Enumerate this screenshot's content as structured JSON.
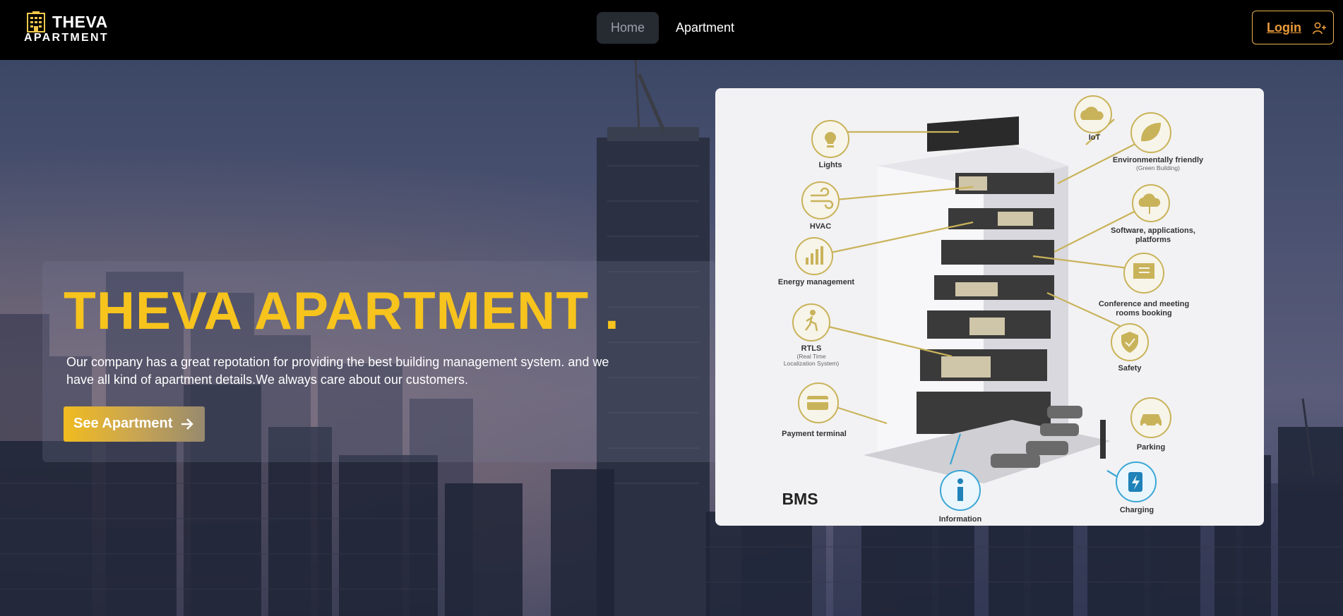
{
  "nav": {
    "logo_line1": "THEVA",
    "logo_line2": "APARTMENT",
    "links": [
      {
        "label": "Home",
        "active": true
      },
      {
        "label": "Apartment",
        "active": false
      }
    ],
    "login_label": "Login",
    "login_icon": "user-plus-icon"
  },
  "hero": {
    "title": "THEVA APARTMENT .",
    "description": "Our company has a great repotation for providing the best building management system. and we have all kind of apartment details.We always care about our customers.",
    "cta_label": "See Apartment",
    "cta_icon": "arrow-right-icon",
    "accent_color": "#f7c31d"
  },
  "bms": {
    "title": "BMS",
    "features": [
      {
        "label": "Lights",
        "icon": "lightbulb-icon"
      },
      {
        "label": "HVAC",
        "icon": "wind-icon"
      },
      {
        "label": "Energy management",
        "icon": "bar-chart-icon"
      },
      {
        "label": "RTLS",
        "sub": "(Real Time Localization System)",
        "icon": "walking-person-icon"
      },
      {
        "label": "Payment terminal",
        "icon": "credit-card-icon"
      },
      {
        "label": "Information",
        "icon": "info-icon"
      },
      {
        "label": "IoT",
        "icon": "cloud-wifi-icon"
      },
      {
        "label": "Environmentally friendly",
        "sub": "(Green Building)",
        "icon": "leaf-icon"
      },
      {
        "label": "Software, applications, platforms",
        "icon": "cloud-network-icon"
      },
      {
        "label": "Conference and meeting rooms booking",
        "icon": "presentation-board-icon"
      },
      {
        "label": "Safety",
        "icon": "shield-check-icon"
      },
      {
        "label": "Parking",
        "icon": "car-icon"
      },
      {
        "label": "Charging",
        "icon": "ev-charging-icon"
      }
    ]
  }
}
